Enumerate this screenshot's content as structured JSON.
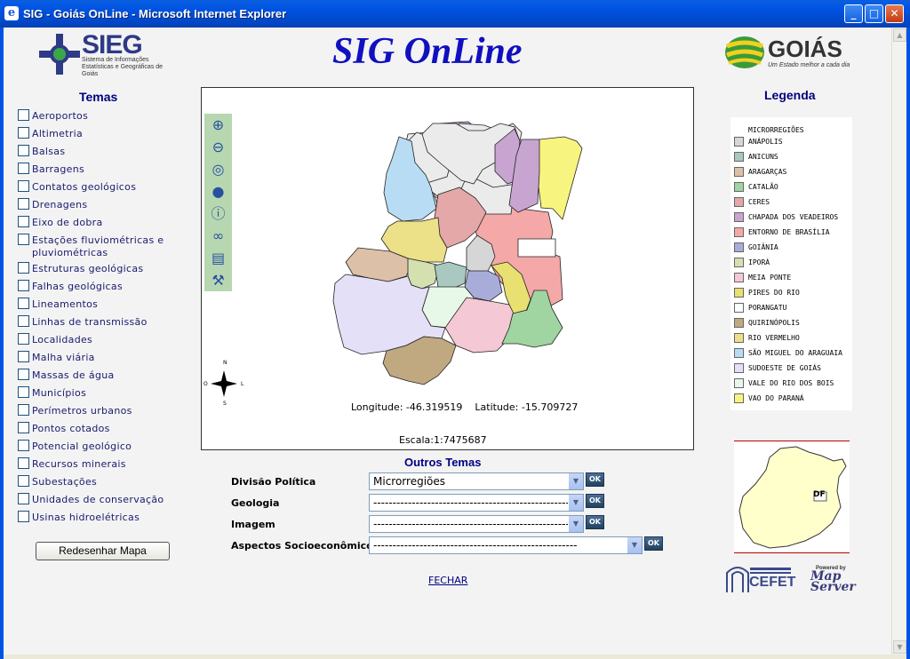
{
  "window": {
    "title": "SIG - Goiás OnLine - Microsoft Internet Explorer",
    "controls": [
      "_",
      "□",
      "✕"
    ]
  },
  "header": {
    "sieg_logo": "SIEG",
    "sieg_sub": "Sistema de Informações Estatísticas e Geográficas de Goiás",
    "app_title": "SIG OnLine",
    "goias_logo": "GOIÁS",
    "goias_sub": "Um Estado melhor a cada dia"
  },
  "temas": {
    "title": "Temas",
    "items": [
      "Aeroportos",
      "Altimetria",
      "Balsas",
      "Barragens",
      "Contatos geológicos",
      "Drenagens",
      "Eixo de dobra",
      "Estações fluviométricas e pluviométricas",
      "Estruturas geológicas",
      "Falhas geológicas",
      "Lineamentos",
      "Linhas de transmissão",
      "Localidades",
      "Malha viária",
      "Massas de água",
      "Municípios",
      "Perímetros urbanos",
      "Pontos cotados",
      "Potencial geológico",
      "Recursos minerais",
      "Subestações",
      "Unidades de conservação",
      "Usinas hidroelétricas"
    ],
    "redraw_button": "Redesenhar Mapa"
  },
  "map": {
    "tools": [
      "zoom-in-icon",
      "zoom-out-icon",
      "pan-icon",
      "globe-icon",
      "info-icon",
      "binoculars-icon",
      "print-icon",
      "hammer-icon"
    ],
    "compass": {
      "n": "N",
      "s": "S",
      "l": "L",
      "o": "O"
    },
    "longitude_label": "Longitude:",
    "longitude": "-46.319519",
    "latitude_label": "Latitude:",
    "latitude": "-15.709727",
    "escala_label": "Escala:",
    "escala": "1:7475687"
  },
  "legend": {
    "title": "Legenda",
    "header": "MICRORREGIÕES",
    "items": [
      {
        "label": "ANÁPOLIS",
        "color": "#d6d6d6"
      },
      {
        "label": "ANICUNS",
        "color": "#a8c8c0"
      },
      {
        "label": "ARAGARÇAS",
        "color": "#dcc0a8"
      },
      {
        "label": "CATALÃO",
        "color": "#a0d4a0"
      },
      {
        "label": "CERES",
        "color": "#e4a8a8"
      },
      {
        "label": "CHAPADA DOS VEADEIROS",
        "color": "#c8a4d0"
      },
      {
        "label": "ENTORNO DE BRASÍLIA",
        "color": "#f4a8a8"
      },
      {
        "label": "GOIÂNIA",
        "color": "#a8acd8"
      },
      {
        "label": "IPORÁ",
        "color": "#d4e0b0"
      },
      {
        "label": "MEIA PONTE",
        "color": "#f4c8d4"
      },
      {
        "label": "PIRES DO RIO",
        "color": "#e8e070"
      },
      {
        "label": "PORANGATU",
        "color": "#ffffff"
      },
      {
        "label": "QUIRINÓPOLIS",
        "color": "#c0a880"
      },
      {
        "label": "RIO VERMELHO",
        "color": "#ece088"
      },
      {
        "label": "SÃO MIGUEL DO ARAGUAIA",
        "color": "#b8dcf4"
      },
      {
        "label": "SUDOESTE DE GOIÁS",
        "color": "#e4e0f8"
      },
      {
        "label": "VALE DO RIO DOS BOIS",
        "color": "#e8f8e8"
      },
      {
        "label": "VAO DO PARANÁ",
        "color": "#f8f480"
      }
    ],
    "minimap_label": "DF"
  },
  "outros": {
    "title": "Outros Temas",
    "rows": [
      {
        "label": "Divisão Política",
        "value": "Microrregiões"
      },
      {
        "label": "Geologia",
        "value": "-----------------------------------------------------"
      },
      {
        "label": "Imagem",
        "value": "-----------------------------------------------------"
      },
      {
        "label": "Aspectos Socioeconômicos",
        "value": "-----------------------------------------------------"
      }
    ],
    "ok": "OK",
    "fechar": "FECHAR"
  },
  "footer": {
    "cefet": "CEFET",
    "powered": "Powered by",
    "mapserver": "Map Server"
  }
}
